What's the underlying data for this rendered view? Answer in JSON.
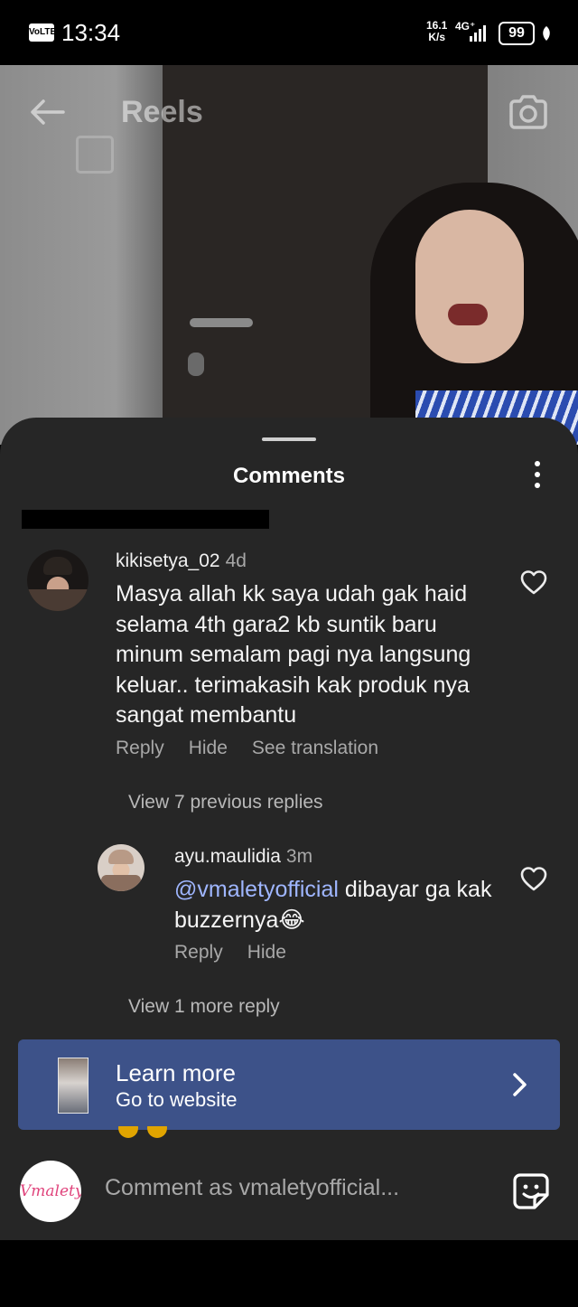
{
  "status_bar": {
    "volte": "VoLTE",
    "time": "13:34",
    "net_speed_value": "16.1",
    "net_speed_unit": "K/s",
    "network": "4G⁺",
    "battery": "99"
  },
  "reels_header": {
    "title": "Reels"
  },
  "comments_sheet": {
    "title": "Comments"
  },
  "comments": [
    {
      "username": "kikisetya_02",
      "time": "4d",
      "text": "Masya allah kk saya udah gak haid selama 4th gara2 kb suntik baru minum semalam pagi nya langsung keluar.. terimakasih kak produk nya sangat membantu",
      "actions": [
        "Reply",
        "Hide",
        "See translation"
      ]
    }
  ],
  "view_previous": "View 7 previous replies",
  "reply": {
    "username": "ayu.maulidia",
    "time": "3m",
    "mention": "@vmaletyofficial",
    "text": " dibayar ga kak buzzernya😂",
    "actions": [
      "Reply",
      "Hide"
    ]
  },
  "view_more": "View 1 more reply",
  "cta": {
    "title": "Learn more",
    "subtitle": "Go to website"
  },
  "composer": {
    "avatar_brand": "Vmalety",
    "placeholder": "Comment as vmaletyofficial..."
  },
  "colors": {
    "sheet_bg": "#262626",
    "cta_bg": "#3d5289",
    "mention": "#9fb6ff",
    "muted_text": "#a8a8a8"
  }
}
